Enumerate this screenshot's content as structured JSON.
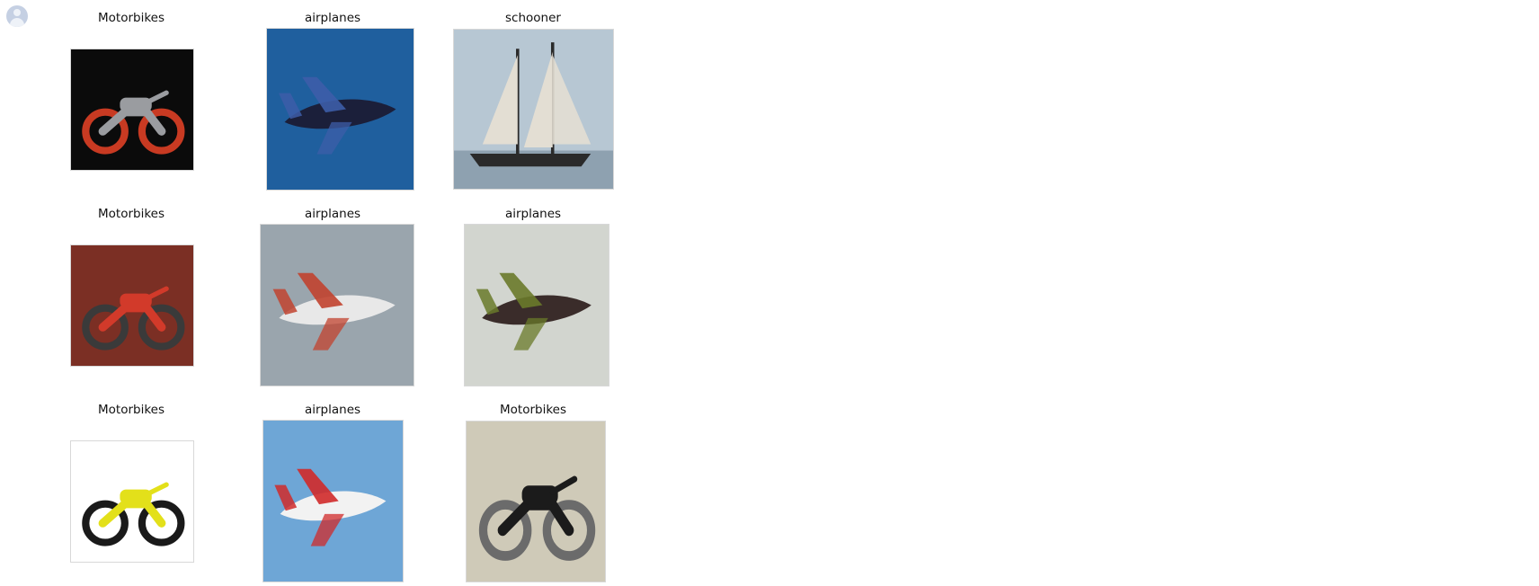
{
  "grid": {
    "cells": [
      {
        "label": "Motorbikes",
        "subject": "motorbike-image",
        "palette": {
          "bg": "#0b0b0b",
          "main": "#9a9ca0",
          "accent": "#c83a22"
        }
      },
      {
        "label": "airplanes",
        "subject": "airplane-image",
        "palette": {
          "bg": "#1f5f9e",
          "main": "#1b1f3a",
          "accent": "#3d5da8"
        }
      },
      {
        "label": "schooner",
        "subject": "schooner-image",
        "palette": {
          "bg": "#b7c7d3",
          "main": "#e3ded3",
          "accent": "#2a2a2a"
        }
      },
      {
        "label": "Motorbikes",
        "subject": "motorbike-image",
        "palette": {
          "bg": "#7b2f24",
          "main": "#d23a2a",
          "accent": "#3a3a3a"
        }
      },
      {
        "label": "airplanes",
        "subject": "airplane-image",
        "palette": {
          "bg": "#9aa5ad",
          "main": "#e8e8e8",
          "accent": "#c1432f"
        }
      },
      {
        "label": "airplanes",
        "subject": "airplane-image",
        "palette": {
          "bg": "#d2d5cf",
          "main": "#3a2c2a",
          "accent": "#6a7a2a"
        }
      },
      {
        "label": "Motorbikes",
        "subject": "motorbike-image",
        "palette": {
          "bg": "#ffffff",
          "main": "#e3e01a",
          "accent": "#1a1a1a"
        }
      },
      {
        "label": "airplanes",
        "subject": "airplane-image",
        "palette": {
          "bg": "#6ea6d6",
          "main": "#f2f2f2",
          "accent": "#d02a2a"
        }
      },
      {
        "label": "Motorbikes",
        "subject": "motorbike-image",
        "palette": {
          "bg": "#cfcab8",
          "main": "#1b1b1b",
          "accent": "#6b6b6b"
        }
      }
    ]
  }
}
